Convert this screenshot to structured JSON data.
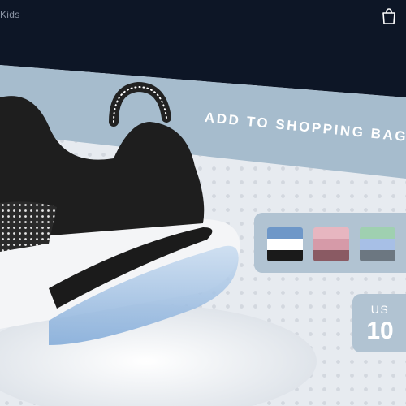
{
  "nav": {
    "partial_item": "Kids"
  },
  "icons": {
    "bag": "shopping-bag-icon"
  },
  "cta": {
    "label": "ADD TO SHOPPING BAG"
  },
  "swatches": [
    {
      "name": "blue-white-black",
      "colors": [
        "#6e97c8",
        "#ffffff",
        "#1a1a1a"
      ]
    },
    {
      "name": "pink-maroon",
      "colors": [
        "#e7b6c0",
        "#d69aa8",
        "#8a5a63"
      ]
    },
    {
      "name": "green-blue-gray",
      "colors": [
        "#9fd0b0",
        "#a7bfe6",
        "#6c7781"
      ]
    }
  ],
  "size": {
    "region": "US",
    "value": "10"
  },
  "colors": {
    "header_bg": "#0d1626",
    "band": "#a6bccd",
    "card": "#b1c3d2"
  }
}
